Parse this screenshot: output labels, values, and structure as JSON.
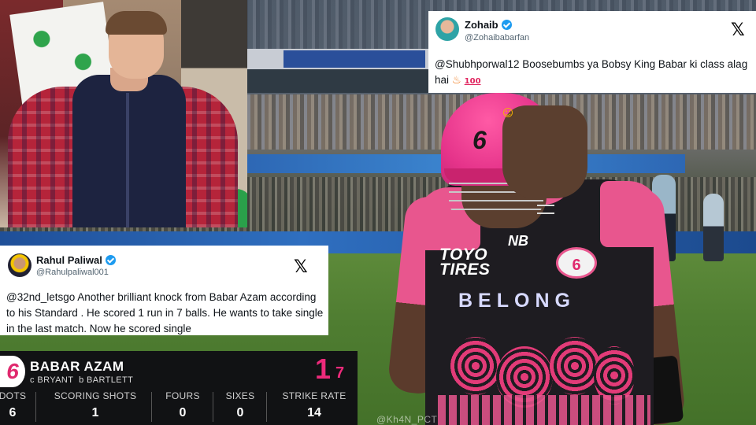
{
  "tweets": [
    {
      "name": "Zohaib",
      "handle": "@Zohaibabarfan",
      "text": "@Shubhporwal12 Boosebumbs ya Bobsy",
      "text_tail": " King Babar ki class alag hai"
    },
    {
      "name": "Rahul Paliwal",
      "handle": "@Rahulpaliwal001",
      "text": "@32nd_letsgo Another brilliant knock from Babar Azam according to his Standard . He scored 1 run in 7 balls. He wants to take single in the last match. Now he scored single"
    }
  ],
  "scorecard": {
    "player": "BABAR AZAM",
    "dismissal": "c BRYANT  b BARTLETT",
    "runs": "1",
    "balls": "7",
    "stats": [
      {
        "label": "DOTS",
        "value": "6"
      },
      {
        "label": "SCORING SHOTS",
        "value": "1"
      },
      {
        "label": "FOURS",
        "value": "0"
      },
      {
        "label": "SIXES",
        "value": "0"
      },
      {
        "label": "STRIKE RATE",
        "value": "14"
      }
    ],
    "team_logo_text": "6"
  },
  "jersey": {
    "sponsor": "TOYO\nTIRES",
    "chest_text": "BELONG",
    "badge": "6"
  },
  "watermark": "@Kh4N_PCT",
  "colors": {
    "team_pink": "#e8568e",
    "score_pink": "#ee2a7b",
    "verified_blue": "#1d9bf0"
  },
  "icons": [
    "verified-badge-icon",
    "x-logo-icon",
    "fire-emoji",
    "hundred-emoji",
    "party-face-emoji"
  ]
}
